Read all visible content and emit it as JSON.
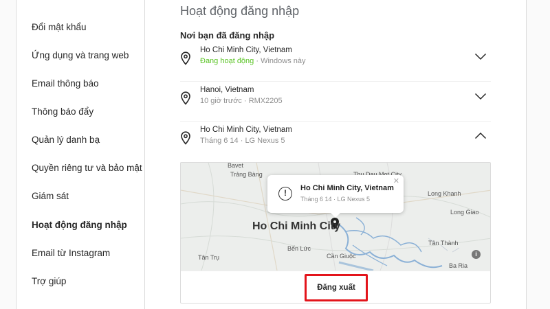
{
  "sidebar": {
    "items": [
      {
        "label": "Đổi mật khẩu"
      },
      {
        "label": "Ứng dụng và trang web"
      },
      {
        "label": "Email thông báo"
      },
      {
        "label": "Thông báo đẩy"
      },
      {
        "label": "Quản lý danh bạ"
      },
      {
        "label": "Quyền riêng tư và bảo mật"
      },
      {
        "label": "Giám sát"
      },
      {
        "label": "Hoạt động đăng nhập",
        "active": true
      },
      {
        "label": "Email từ Instagram"
      },
      {
        "label": "Trợ giúp"
      }
    ]
  },
  "main": {
    "title": "Hoạt động đăng nhập",
    "section_title": "Nơi bạn đã đăng nhập",
    "locations": [
      {
        "city": "Ho Chi Minh City, Vietnam",
        "status": "Đang hoạt động",
        "device": "· Windows này",
        "expanded": false
      },
      {
        "city": "Hanoi, Vietnam",
        "status": "10 giờ trước",
        "device": "· RMX2205",
        "expanded": false
      },
      {
        "city": "Ho Chi Minh City, Vietnam",
        "status": "Tháng 6 14",
        "device": "· LG Nexus 5",
        "expanded": true
      }
    ],
    "map": {
      "popup_city": "Ho Chi Minh City, Vietnam",
      "popup_meta": "Tháng 6 14 · LG Nexus 5",
      "labels": {
        "bavet": "Bavet",
        "trang_bang": "Trảng Bàng",
        "thu_dau_mot": "Thu Dau Mot City",
        "long_khanh": "Long Khanh",
        "hcmc": "Ho Chi Minh City",
        "long_giao": "Long Giao",
        "ben_luc": "Bến Lức",
        "tan_thanh": "Tân Thành",
        "tan_tru": "Tân Trụ",
        "can_giuoc": "Cần Giuộc",
        "ba_ria": "Ba Ria"
      }
    },
    "logout_label": "Đăng xuất"
  },
  "colors": {
    "active_status": "#58c322",
    "highlight_border": "#e3141b"
  }
}
